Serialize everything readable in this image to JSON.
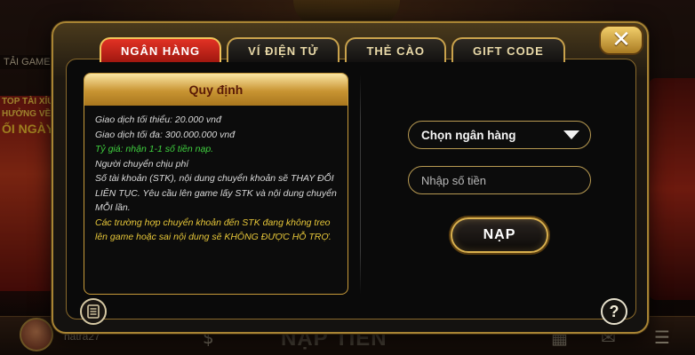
{
  "background": {
    "side_tab_label": "TẢI GAME",
    "promo_lines": [
      "TOP TÀI XỈU",
      "HƯỞNG VỀ",
      "ỐI NGÀY"
    ],
    "username": "hatra27",
    "nav_title": "NẠP TIỀN"
  },
  "tabs": [
    {
      "label": "NGÂN HÀNG",
      "active": true
    },
    {
      "label": "VÍ ĐIỆN TỬ",
      "active": false
    },
    {
      "label": "THẺ CÀO",
      "active": false
    },
    {
      "label": "GIFT CODE",
      "active": false
    }
  ],
  "rules": {
    "title": "Quy định",
    "lines": [
      {
        "text": "Giao dịch tối thiểu: 20.000 vnđ",
        "color": "white"
      },
      {
        "text": "Giao dịch tối đa: 300.000.000 vnđ",
        "color": "white"
      },
      {
        "text": "Tỷ giá: nhận 1-1 số tiền nạp.",
        "color": "green"
      },
      {
        "text": "Người chuyển chịu phí",
        "color": "white"
      },
      {
        "text": "Số tài khoản (STK), nội dung chuyển khoản sẽ THAY ĐỔI LIÊN TỤC. Yêu cầu lên game lấy STK và nội dung chuyển MỖI lần.",
        "color": "white"
      },
      {
        "text": "Các trường hợp chuyển khoản đến STK đang không treo lên game hoặc sai nội dung sẽ KHÔNG ĐƯỢC HỖ TRỢ.",
        "color": "yellow"
      }
    ]
  },
  "form": {
    "bank_select_label": "Chọn ngân hàng",
    "amount_placeholder": "Nhập số tiền",
    "submit_label": "NẠP"
  },
  "icons": {
    "close": "close-icon",
    "document": "document-icon",
    "help": "help-icon"
  },
  "colors": {
    "active_tab": "#d8261c",
    "gold_border": "#c9a24c",
    "green_text": "#3fd03f",
    "yellow_text": "#e6c639"
  }
}
